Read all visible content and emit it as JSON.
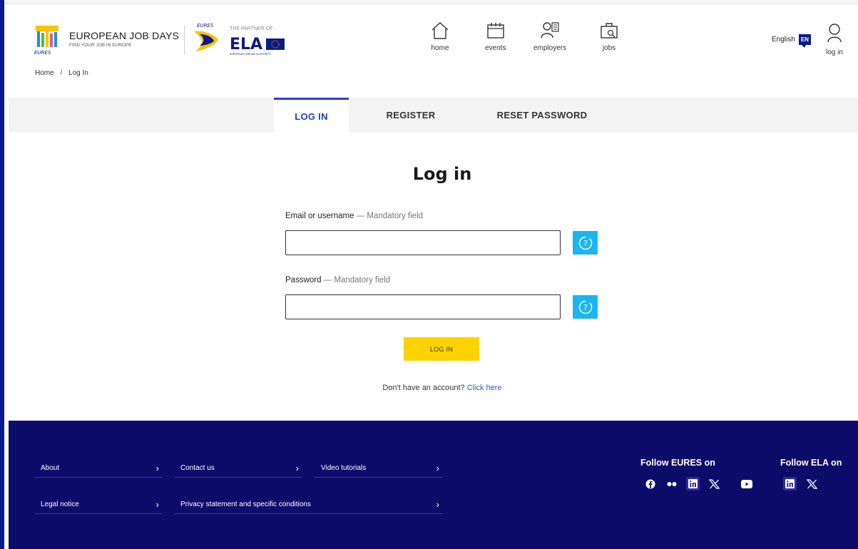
{
  "header": {
    "brand_title": "EUROPEAN JOB DAYS",
    "brand_subtitle": "FIND YOUR JOB IN EUROPE",
    "partner_text": "THE PARTNER OF",
    "ela_text": "ELA",
    "ela_subtext": "EUROPEAN LABOUR AUTHORITY",
    "nav": [
      {
        "label": "home",
        "icon": "home-icon"
      },
      {
        "label": "events",
        "icon": "calendar-icon"
      },
      {
        "label": "employers",
        "icon": "employers-icon"
      },
      {
        "label": "jobs",
        "icon": "briefcase-icon"
      }
    ],
    "language": {
      "label": "English",
      "code": "EN"
    },
    "login_label": "log in"
  },
  "breadcrumb": {
    "items": [
      "Home",
      "Log In"
    ],
    "separator": "/"
  },
  "tabs": [
    {
      "label": "LOG IN",
      "active": true
    },
    {
      "label": "REGISTER",
      "active": false
    },
    {
      "label": "RESET PASSWORD",
      "active": false
    }
  ],
  "form": {
    "title": "Log in",
    "email_label": "Email or username",
    "email_mandatory": " — Mandatory field",
    "email_value": "",
    "password_label": "Password",
    "password_mandatory": " — Mandatory field",
    "password_value": "",
    "submit_label": "LOG IN",
    "no_account_text": "Don't have an account? ",
    "click_here": "Click here"
  },
  "footer": {
    "links_row1": [
      "About",
      "Contact us",
      "Video tutorials"
    ],
    "links_row2": [
      "Legal notice",
      "Privacy statement and specific conditions"
    ],
    "follow_eures": "Follow EURES on",
    "follow_ela": "Follow ELA on",
    "eures_social": [
      "facebook-icon",
      "flickr-icon",
      "linkedin-icon",
      "x-icon",
      "youtube-icon"
    ],
    "ela_social": [
      "linkedin-icon",
      "x-icon"
    ]
  },
  "colors": {
    "primary_blue": "#0b1a8a",
    "footer_bg": "#0e0c6b",
    "active_tab": "#1f3fbf",
    "help_button": "#1bb6ef",
    "submit_button": "#ffd200",
    "link": "#2a59e0"
  }
}
